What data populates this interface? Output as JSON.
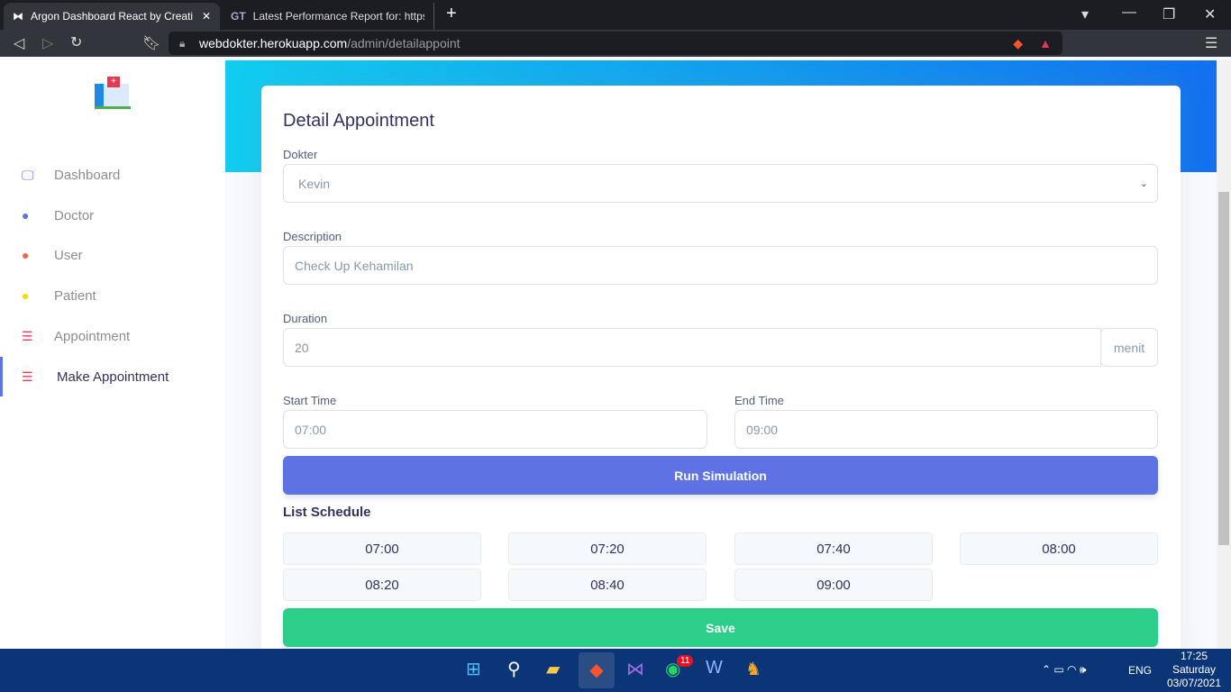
{
  "browser": {
    "tabs": [
      {
        "title": "Argon Dashboard React by Creati"
      },
      {
        "title": "Latest Performance Report for: https://"
      }
    ],
    "url_host": "webdokter.herokuapp.com",
    "url_path": "/admin/detailappoint"
  },
  "sidebar": {
    "items": [
      {
        "label": "Dashboard",
        "color": "#5e72e4"
      },
      {
        "label": "Doctor",
        "color": "#5e72e4"
      },
      {
        "label": "User",
        "color": "#fb6340"
      },
      {
        "label": "Patient",
        "color": "#ffd600"
      },
      {
        "label": "Appointment",
        "color": "#f5365c"
      },
      {
        "label": "Make Appointment",
        "color": "#f5365c"
      }
    ]
  },
  "form": {
    "title": "Detail Appointment",
    "dokter_label": "Dokter",
    "dokter_value": "Kevin",
    "description_label": "Description",
    "description_value": "Check Up Kehamilan",
    "duration_label": "Duration",
    "duration_value": "20",
    "duration_unit": "menit",
    "start_label": "Start Time",
    "start_value": "07:00",
    "end_label": "End Time",
    "end_value": "09:00",
    "run_label": "Run Simulation",
    "schedule_title": "List Schedule",
    "schedule": [
      "07:00",
      "07:20",
      "07:40",
      "08:00",
      "08:20",
      "08:40",
      "09:00"
    ],
    "save_label": "Save"
  },
  "taskbar": {
    "whatsapp_badge": "11",
    "lang": "ENG",
    "time": "17:25",
    "day": "Saturday",
    "date": "03/07/2021"
  }
}
